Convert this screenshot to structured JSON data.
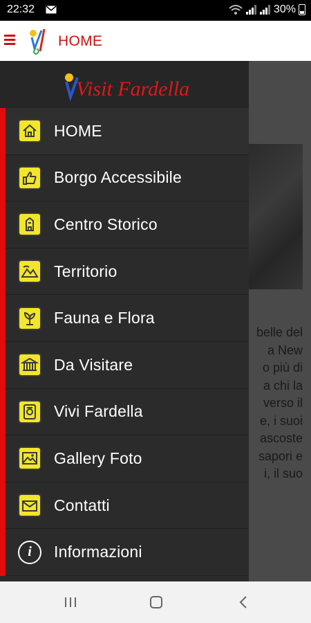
{
  "status": {
    "time": "22:32",
    "battery": "30%"
  },
  "toolbar": {
    "title": "HOME"
  },
  "drawer": {
    "brand": "Visit Fardella",
    "items": [
      {
        "label": "HOME",
        "icon": "home-icon"
      },
      {
        "label": "Borgo Accessibile",
        "icon": "thumbs-up-icon"
      },
      {
        "label": "Centro Storico",
        "icon": "tower-icon"
      },
      {
        "label": "Territorio",
        "icon": "mountains-icon"
      },
      {
        "label": "Fauna e Flora",
        "icon": "plant-icon"
      },
      {
        "label": "Da Visitare",
        "icon": "building-icon"
      },
      {
        "label": "Vivi Fardella",
        "icon": "badge-icon"
      },
      {
        "label": "Gallery Foto",
        "icon": "gallery-icon"
      },
      {
        "label": "Contatti",
        "icon": "envelope-icon"
      },
      {
        "label": "Informazioni",
        "icon": "info-icon"
      }
    ]
  },
  "content": {
    "lines": [
      "belle del",
      "a New",
      "o più di",
      "a chi la",
      "verso il",
      "e, i suoi",
      "ascoste",
      "sapori e",
      "i, il suo"
    ]
  },
  "colors": {
    "accent": "#e20b0b",
    "icon_bg": "#f2e629",
    "drawer_bg": "#2b2b2b"
  }
}
